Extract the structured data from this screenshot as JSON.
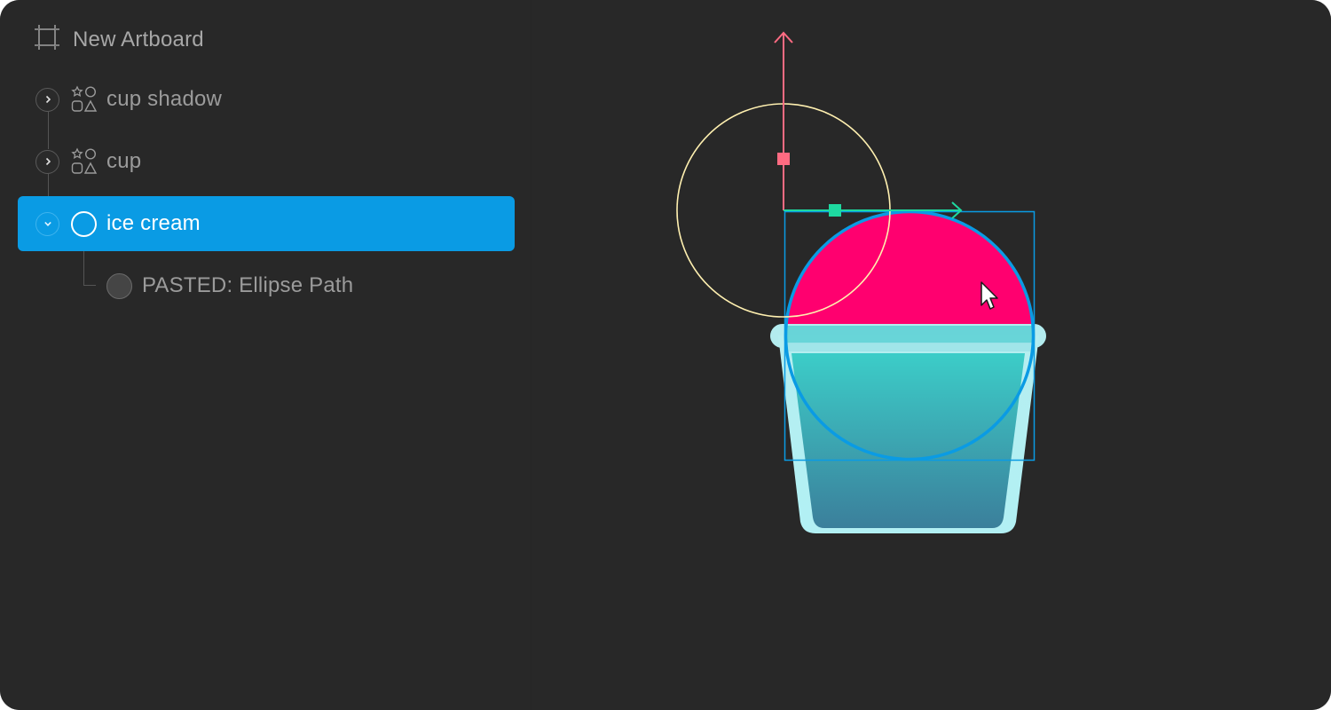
{
  "layers": {
    "artboard": {
      "label": "New Artboard",
      "icon": "artboard-icon"
    },
    "items": [
      {
        "label": "cup shadow",
        "icon": "shapes-group-icon",
        "expanded": false,
        "selected": false
      },
      {
        "label": "cup",
        "icon": "shapes-group-icon",
        "expanded": false,
        "selected": false
      },
      {
        "label": "ice cream",
        "icon": "ellipse-icon",
        "expanded": true,
        "selected": true
      },
      {
        "label": "PASTED: Ellipse Path",
        "icon": "ellipse-icon",
        "expanded": false,
        "selected": false,
        "child_of": "ice cream"
      }
    ]
  },
  "colors": {
    "selection": "#0a9be4",
    "ice_cream": "#ff006f",
    "y_axis": "#ff6b82",
    "x_axis": "#1ed9a0",
    "guide_circle": "#fff0b0"
  }
}
